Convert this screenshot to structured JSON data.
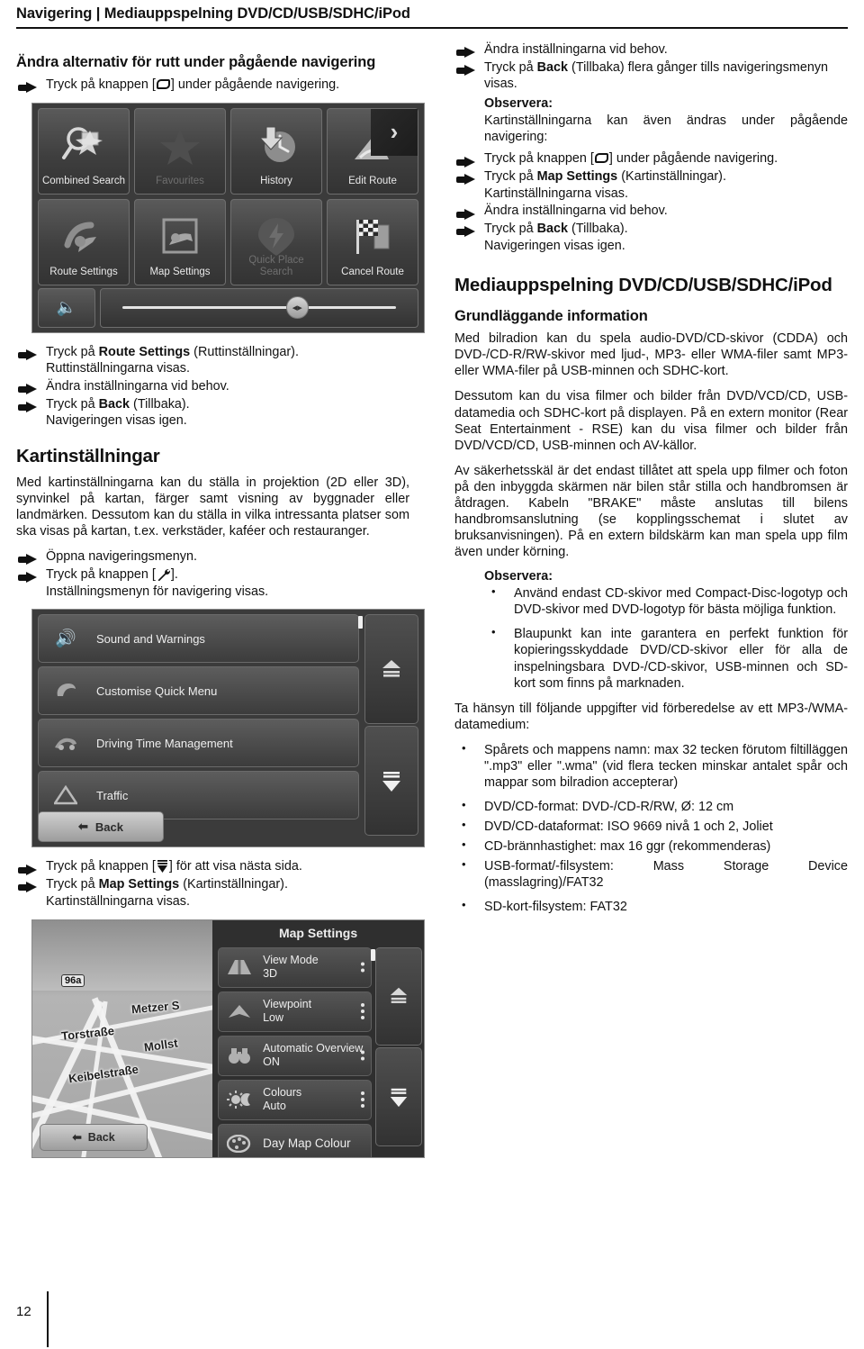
{
  "header": {
    "title": "Navigering | Mediauppspelning DVD/CD/USB/SDHC/iPod"
  },
  "footer": {
    "page_number": "12"
  },
  "left_column": {
    "heading1": "Ändra alternativ för rutt under pågående navigering",
    "step_press_key_nav": {
      "pre": "Tryck på knappen [",
      "post": "] under pågående navigering."
    },
    "steps_after_shot1": [
      {
        "pre": "Tryck på ",
        "bold": "Route Settings",
        "post": " (Ruttinställningar).",
        "result": "Ruttinställningarna visas."
      },
      {
        "pre": "Ändra inställningarna vid behov.",
        "bold": "",
        "post": "",
        "result": ""
      },
      {
        "pre": "Tryck på ",
        "bold": "Back",
        "post": " (Tillbaka).",
        "result": "Navigeringen visas igen."
      }
    ],
    "heading2": "Kartinställningar",
    "para1": "Med kartinställningarna kan du ställa in projektion (2D eller 3D), synvinkel på kartan, färger samt visning av byggnader eller landmärken. Dessutom kan du ställa in vilka intressanta platser som ska visas på kartan, t.ex. verkstäder, kaféer och restauranger.",
    "step_open_menu": "Öppna navigeringsmenyn.",
    "step_press_wrench": {
      "pre": "Tryck på knappen [",
      "post": "]."
    },
    "result_settings_menu": "Inställningsmenyn för navigering visas.",
    "step_next_page": {
      "pre": "Tryck på knappen [",
      "post": "] för att visa nästa sida."
    },
    "step_map_settings": {
      "pre": "Tryck på ",
      "bold": "Map Settings",
      "post": " (Kartinställningar).",
      "result": "Kartinställningarna visas."
    }
  },
  "right_column": {
    "step_change_settings": "Ändra inställningarna vid behov.",
    "step_back_multiple": {
      "pre": "Tryck på ",
      "bold": "Back",
      "post": " (Tillbaka) flera gånger tills navigeringsmenyn visas."
    },
    "note1_label": "Observera:",
    "note1_text": "Kartinställningarna kan även ändras under pågående navigering:",
    "note1_steps": [
      {
        "pre": "Tryck på knappen [",
        "bold": "",
        "post": "] under pågående navigering.",
        "result": ""
      },
      {
        "pre": "Tryck på ",
        "bold": "Map Settings",
        "post": " (Kartinställningar).",
        "result": "Kartinställningarna visas."
      },
      {
        "pre": "Ändra inställningarna vid behov.",
        "bold": "",
        "post": "",
        "result": ""
      },
      {
        "pre": "Tryck på ",
        "bold": "Back",
        "post": " (Tillbaka).",
        "result": "Navigeringen visas igen."
      }
    ],
    "heading_media": "Mediauppspelning DVD/CD/USB/SDHC/iPod",
    "heading_basic": "Grundläggande information",
    "para1": "Med bilradion kan du spela audio-DVD/CD-skivor (CDDA) och DVD-/CD-R/RW-skivor med ljud-, MP3- eller WMA-filer samt MP3- eller WMA-filer på USB-minnen och SDHC-kort.",
    "para2": "Dessutom kan du visa filmer och bilder från DVD/VCD/CD, USB-datamedia och SDHC-kort på displayen. På en extern monitor (Rear Seat Entertainment - RSE) kan du visa filmer och bilder från DVD/VCD/CD, USB-minnen och AV-källor.",
    "para3": "Av säkerhetsskäl är det endast tillåtet att spela upp filmer och foton på den inbyggda skärmen när bilen står stilla och handbromsen är åtdragen. Kabeln \"BRAKE\" måste anslutas till bilens handbromsanslutning (se kopplingsschemat i slutet av bruksanvisningen). På en extern bildskärm kan man spela upp film även under körning.",
    "note2_label": "Observera:",
    "note2_bullets": [
      "Använd endast CD-skivor med Compact-Disc-logotyp och DVD-skivor med DVD-logotyp för bästa möjliga funktion.",
      "Blaupunkt kan inte garantera en perfekt funktion för kopieringsskyddade DVD/CD-skivor eller för alla de inspelningsbara DVD-/CD-skivor, USB-minnen och SD-kort som finns på marknaden."
    ],
    "para4": "Ta hänsyn till följande uppgifter vid förberedelse av ett MP3-/WMA-datamedium:",
    "spec_bullets": [
      "Spårets och mappens namn: max 32 tecken förutom filtilläggen \".mp3\" eller \".wma\" (vid flera tecken minskar antalet spår och mappar som bilradion accepterar)",
      "DVD/CD-format: DVD-/CD-R/RW, Ø: 12 cm",
      "DVD/CD-dataformat: ISO 9669 nivå 1 och 2, Joliet",
      "CD-brännhastighet: max 16 ggr (rekommenderas)",
      "USB-format/-filsystem: Mass Storage Device (masslagring)/FAT32",
      "SD-kort-filsystem: FAT32"
    ]
  },
  "screenshot_nav_menu": {
    "tiles": [
      {
        "label": "Combined Search",
        "icon": "magnifier-star-icon",
        "dim": false
      },
      {
        "label": "Favourites",
        "icon": "star-icon",
        "dim": true
      },
      {
        "label": "History",
        "icon": "clock-arrow-icon",
        "dim": false
      },
      {
        "label": "Edit Route",
        "icon": "edit-route-icon",
        "dim": false
      },
      {
        "label": "Route Settings",
        "icon": "route-settings-icon",
        "dim": false
      },
      {
        "label": "Map Settings",
        "icon": "map-settings-icon",
        "dim": false
      },
      {
        "label": "Quick Place Search",
        "icon": "quick-place-icon",
        "dim": true
      },
      {
        "label": "Cancel Route",
        "icon": "checkered-flag-icon",
        "dim": false
      }
    ],
    "volume_icon": "speaker-icon",
    "corner_icon": "chevron-right-icon"
  },
  "screenshot_settings_list": {
    "rows": [
      {
        "label": "Sound and Warnings",
        "icon": "speaker-icon"
      },
      {
        "label": "Customise Quick Menu",
        "icon": "quick-menu-icon"
      },
      {
        "label": "Driving Time Management",
        "icon": "driving-time-icon"
      },
      {
        "label": "Traffic",
        "icon": "warning-triangle-icon"
      }
    ],
    "back_label": "Back",
    "scroll_up_icon": "page-up-icon",
    "scroll_down_icon": "page-down-icon"
  },
  "screenshot_map_settings": {
    "title": "Map Settings",
    "rows": [
      {
        "label": "View Mode",
        "value": "3D",
        "icon": "view-mode-icon"
      },
      {
        "label": "Viewpoint",
        "value": "Low",
        "icon": "viewpoint-icon"
      },
      {
        "label": "Automatic Overview",
        "value": "ON",
        "icon": "binoculars-icon"
      },
      {
        "label": "Colours",
        "value": "Auto",
        "icon": "sun-moon-icon"
      },
      {
        "label": "Day Map Colour",
        "value": "",
        "icon": "palette-icon"
      }
    ],
    "map_labels": [
      "96a",
      "Metzer S",
      "Torstraße",
      "Mollst",
      "Keibelstraße"
    ],
    "back_label": "Back"
  }
}
